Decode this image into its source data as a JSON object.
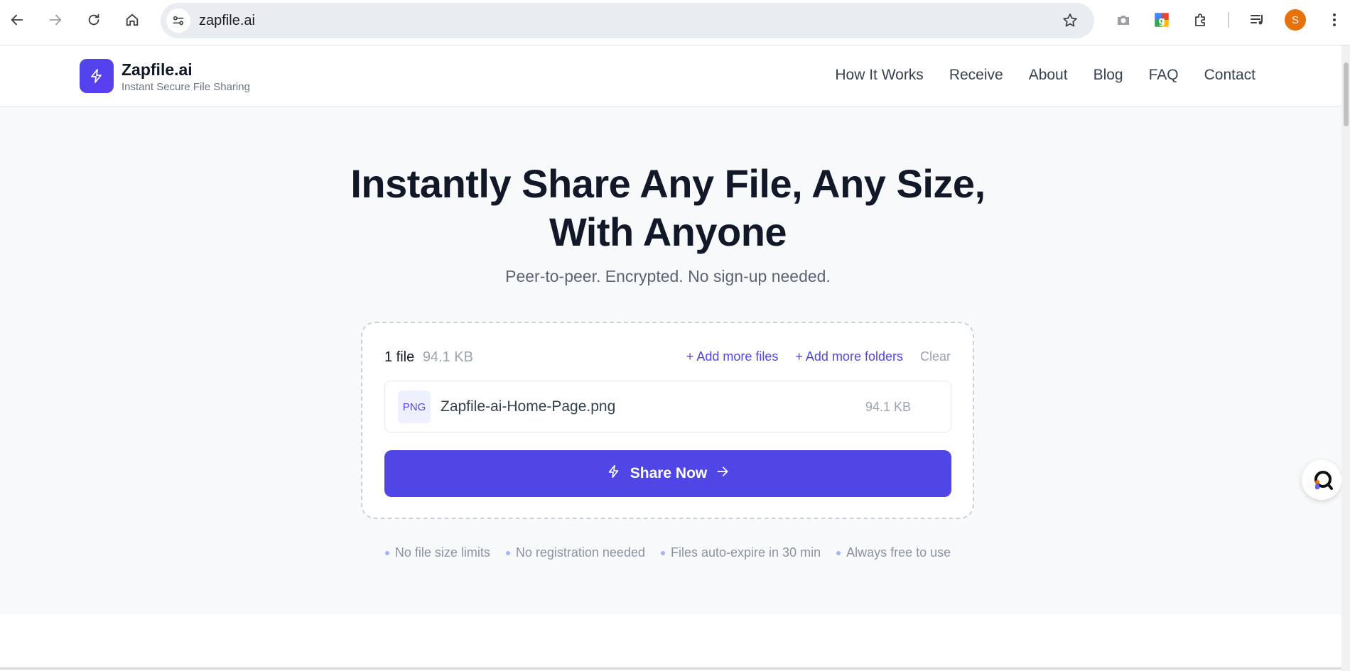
{
  "browser": {
    "url": "zapfile.ai",
    "profile_initial": "S",
    "profile_color": "#e8710a"
  },
  "site": {
    "brand": "Zapfile.ai",
    "tagline": "Instant Secure File Sharing",
    "brand_color": "#4f46e5",
    "nav": [
      {
        "label": "How It Works"
      },
      {
        "label": "Receive"
      },
      {
        "label": "About"
      },
      {
        "label": "Blog"
      },
      {
        "label": "FAQ"
      },
      {
        "label": "Contact"
      }
    ]
  },
  "hero": {
    "headline_line1": "Instantly Share Any File, Any Size,",
    "headline_line2": "With Anyone",
    "subheadline": "Peer-to-peer. Encrypted. No sign-up needed."
  },
  "upload": {
    "file_count": "1 file",
    "total_size": "94.1 KB",
    "add_files": "+ Add more files",
    "add_folders": "+ Add more folders",
    "clear": "Clear",
    "files": [
      {
        "type": "PNG",
        "name": "Zapfile-ai-Home-Page.png",
        "size": "94.1 KB"
      }
    ],
    "share_button": "Share Now"
  },
  "features": [
    "No file size limits",
    "No registration needed",
    "Files auto-expire in 30 min",
    "Always free to use"
  ]
}
